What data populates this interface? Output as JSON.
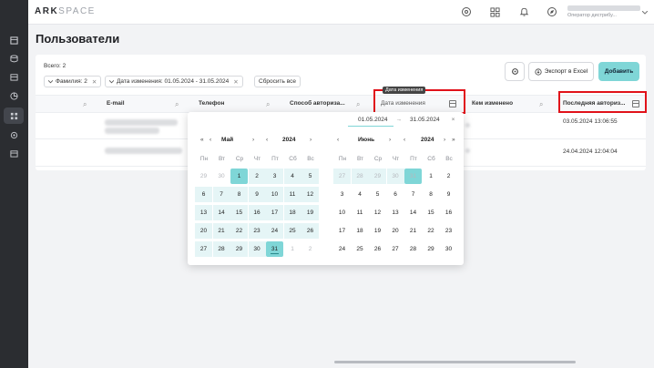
{
  "app": {
    "logo_main": "ARK",
    "logo_accent": "SPACE"
  },
  "user": {
    "role": "Оператор дистрибу..."
  },
  "page": {
    "title": "Пользователи"
  },
  "filters": {
    "total": "Всего: 2",
    "chip_lastname": "Фамилия: 2",
    "chip_date": "Дата изменения: 01.05.2024 - 31.05.2024",
    "reset": "Сбросить все"
  },
  "toolbar": {
    "export": "Экспорт в Excel",
    "add": "Добавить"
  },
  "table": {
    "headers": {
      "email": "E-mail",
      "phone": "Телефон",
      "auth_method": "Способ авториза...",
      "modified_date": "Дата изменения",
      "modified_by": "Кем изменено",
      "last_auth": "Последняя авториз..."
    },
    "rows": [
      {
        "last_auth": "03.05.2024 13:06:55"
      },
      {
        "last_auth": "24.04.2024 12:04:04"
      }
    ]
  },
  "tooltip": "Дата изменения",
  "datepicker": {
    "from": "01.05.2024",
    "to": "31.05.2024",
    "arrow": "→",
    "clear": "×",
    "weekdays": [
      "Пн",
      "Вт",
      "Ср",
      "Чт",
      "Пт",
      "Сб",
      "Вс"
    ],
    "left": {
      "month": "Май",
      "year": "2024",
      "weeks": [
        [
          "29",
          "30",
          "1",
          "2",
          "3",
          "4",
          "5"
        ],
        [
          "6",
          "7",
          "8",
          "9",
          "10",
          "11",
          "12"
        ],
        [
          "13",
          "14",
          "15",
          "16",
          "17",
          "18",
          "19"
        ],
        [
          "20",
          "21",
          "22",
          "23",
          "24",
          "25",
          "26"
        ],
        [
          "27",
          "28",
          "29",
          "30",
          "31",
          "1",
          "2"
        ]
      ]
    },
    "right": {
      "month": "Июнь",
      "year": "2024",
      "weeks": [
        [
          "27",
          "28",
          "29",
          "30",
          "31",
          "1",
          "2"
        ],
        [
          "3",
          "4",
          "5",
          "6",
          "7",
          "8",
          "9"
        ],
        [
          "10",
          "11",
          "12",
          "13",
          "14",
          "15",
          "16"
        ],
        [
          "17",
          "18",
          "19",
          "20",
          "21",
          "22",
          "23"
        ],
        [
          "24",
          "25",
          "26",
          "27",
          "28",
          "29",
          "30"
        ]
      ]
    }
  },
  "colors": {
    "accent": "#7fd6d7",
    "highlight": "#e1121a",
    "sidebar": "#2b2d31"
  }
}
